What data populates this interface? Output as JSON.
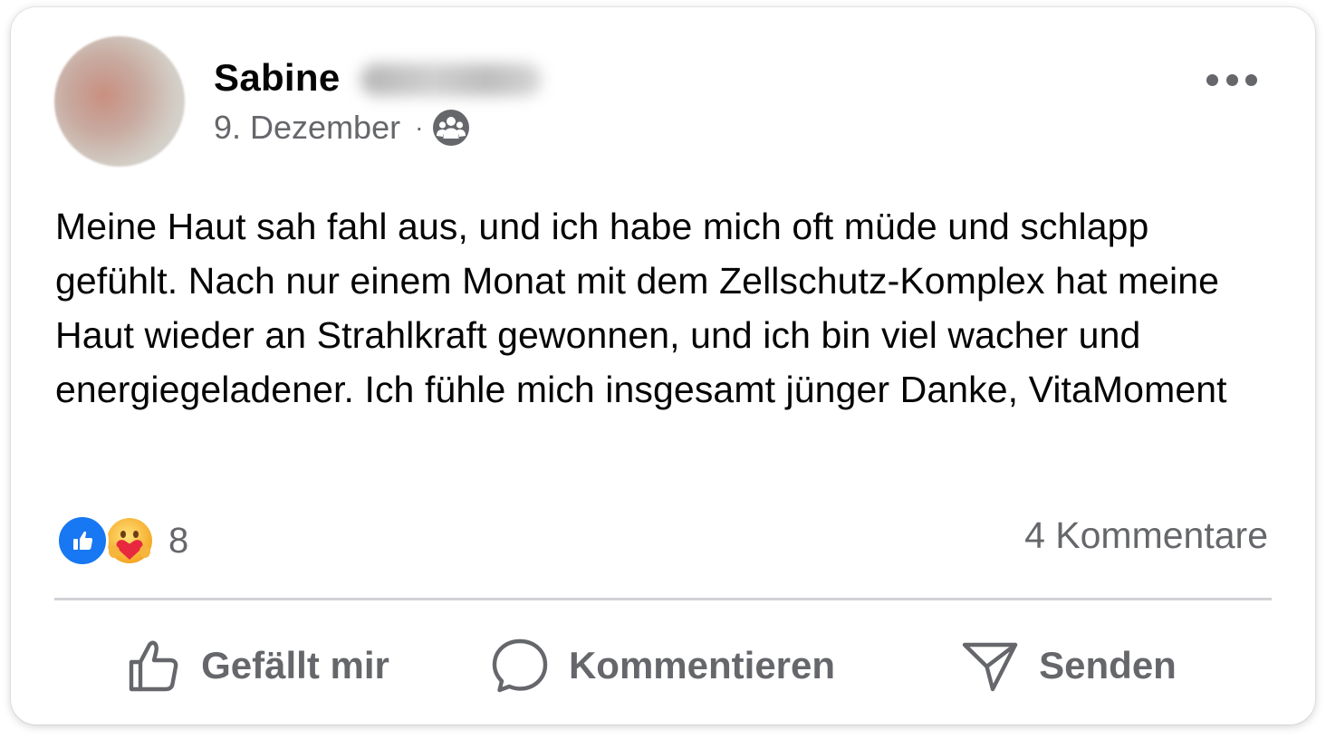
{
  "post": {
    "author_first_name": "Sabine",
    "date": "9. Dezember",
    "separator": "·",
    "audience_icon": "friends-icon",
    "text": "Meine Haut sah fahl aus, und ich habe mich oft müde und schlapp gefühlt. Nach nur einem Monat mit dem Zellschutz-Komplex hat meine Haut wieder an Strahlkraft gewonnen, und ich bin viel wacher und energiegeladener. Ich fühle mich insgesamt jünger Danke, VitaMoment"
  },
  "stats": {
    "reaction_icons": [
      "like-icon",
      "care-icon"
    ],
    "reaction_count": "8",
    "comments_label": "4 Kommentare"
  },
  "actions": {
    "like_label": "Gefällt mir",
    "comment_label": "Kommentieren",
    "share_label": "Senden"
  },
  "colors": {
    "accent_blue": "#1877f2",
    "secondary_text": "#65676b",
    "primary_text": "#050505"
  }
}
